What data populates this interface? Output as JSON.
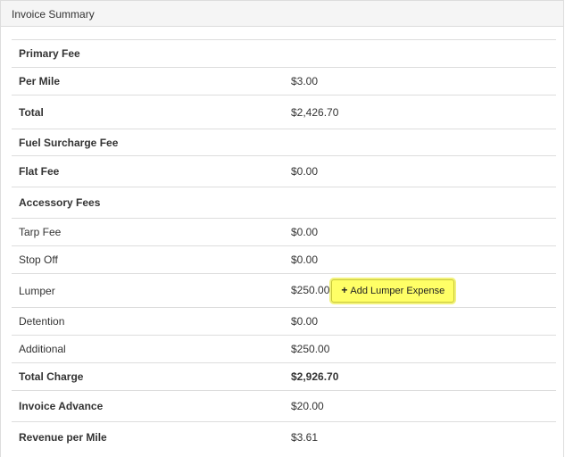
{
  "panel": {
    "title": "Invoice Summary"
  },
  "rows": [
    {
      "label": "Primary Fee",
      "value": ""
    },
    {
      "label": "Per Mile",
      "value": "$3.00"
    },
    {
      "label": "Total",
      "value": "$2,426.70"
    },
    {
      "label": "Fuel Surcharge Fee",
      "value": ""
    },
    {
      "label": "Flat Fee",
      "value": "$0.00"
    },
    {
      "label": "Accessory Fees",
      "value": ""
    },
    {
      "label": "Tarp Fee",
      "value": "$0.00"
    },
    {
      "label": "Stop Off",
      "value": "$0.00"
    },
    {
      "label": "Lumper",
      "value": "$250.00"
    },
    {
      "label": "Detention",
      "value": "$0.00"
    },
    {
      "label": "Additional",
      "value": "$250.00"
    },
    {
      "label": "Total Charge",
      "value": "$2,926.70"
    },
    {
      "label": "Invoice Advance",
      "value": "$20.00"
    },
    {
      "label": "Revenue per Mile",
      "value": "$3.61"
    }
  ],
  "lumper_button": {
    "icon": "+",
    "label": "Add Lumper Expense"
  },
  "colors": {
    "highlight": "#ffff66",
    "heading_bg": "#f5f5f5",
    "border": "#dddddd"
  }
}
